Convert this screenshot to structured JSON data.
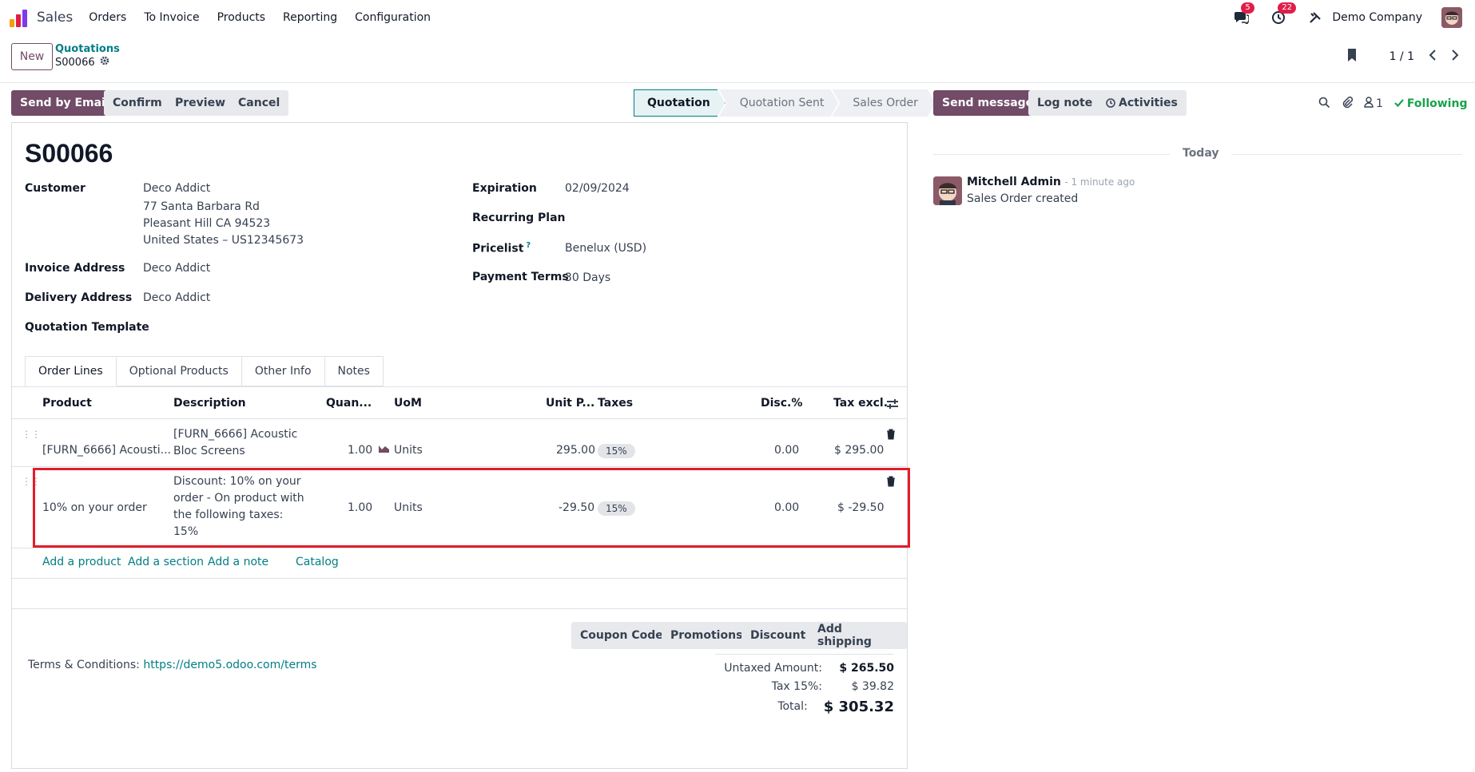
{
  "navbar": {
    "app_name": "Sales",
    "menu": [
      "Orders",
      "To Invoice",
      "Products",
      "Reporting",
      "Configuration"
    ],
    "messages_count": "5",
    "activities_count": "22",
    "company": "Demo Company"
  },
  "control": {
    "new_label": "New",
    "breadcrumb_parent": "Quotations",
    "breadcrumb_current": "S00066",
    "pager": "1 / 1"
  },
  "actions": {
    "send_email": "Send by Email",
    "confirm": "Confirm",
    "preview": "Preview",
    "cancel": "Cancel"
  },
  "status": {
    "stages": [
      "Quotation",
      "Quotation Sent",
      "Sales Order"
    ],
    "current": "Quotation"
  },
  "form": {
    "reference": "S00066",
    "customer_label": "Customer",
    "customer_name": "Deco Addict",
    "customer_street": "77 Santa Barbara Rd",
    "customer_city": "Pleasant Hill CA 94523",
    "customer_country": "United States – US12345673",
    "invoice_address_label": "Invoice Address",
    "invoice_address": "Deco Addict",
    "delivery_address_label": "Delivery Address",
    "delivery_address": "Deco Addict",
    "template_label": "Quotation Template",
    "expiration_label": "Expiration",
    "expiration": "02/09/2024",
    "recurring_label": "Recurring Plan",
    "pricelist_label": "Pricelist",
    "pricelist_help": "?",
    "pricelist": "Benelux (USD)",
    "payment_terms_label": "Payment Terms",
    "payment_terms": "30 Days"
  },
  "tabs": [
    "Order Lines",
    "Optional Products",
    "Other Info",
    "Notes"
  ],
  "table": {
    "headers": [
      "Product",
      "Description",
      "Quan...",
      "UoM",
      "Unit P...",
      "Taxes",
      "Disc.%",
      "Tax excl."
    ],
    "rows": [
      {
        "product": "[FURN_6666] Acousti...",
        "description_1": "[FURN_6666] Acoustic",
        "description_2": "Bloc Screens",
        "quantity": "1.00",
        "uom": "Units",
        "unit_price": "295.00",
        "tax": "15%",
        "discount": "0.00",
        "subtotal": "$ 295.00"
      },
      {
        "product": "10% on your order",
        "description_1": "Discount: 10% on your",
        "description_2": "order - On product with",
        "description_3": "the following taxes:",
        "description_4": "15%",
        "quantity": "1.00",
        "uom": "Units",
        "unit_price": "-29.50",
        "tax": "15%",
        "discount": "0.00",
        "subtotal": "$ -29.50"
      }
    ],
    "add_product": "Add a product",
    "add_section": "Add a section",
    "add_note": "Add a note",
    "catalog": "Catalog"
  },
  "footer_buttons": {
    "coupon": "Coupon Code",
    "promotions": "Promotions",
    "discount": "Discount",
    "shipping": "Add shipping"
  },
  "terms": {
    "label": "Terms & Conditions:",
    "link": "https://demo5.odoo.com/terms"
  },
  "totals": {
    "untaxed_label": "Untaxed Amount:",
    "untaxed": "$ 265.50",
    "tax_label": "Tax 15%:",
    "tax": "$ 39.82",
    "total_label": "Total:",
    "total": "$ 305.32"
  },
  "chatter": {
    "send_message": "Send message",
    "log_note": "Log note",
    "activities": "Activities",
    "followers_count": "1",
    "following": "Following",
    "today": "Today",
    "author": "Mitchell Admin",
    "time": "- 1 minute ago",
    "message": "Sales Order created"
  },
  "colors": {
    "primary": "#714b67",
    "link": "#017e84",
    "highlight": "#e11d2a",
    "following": "#16a34a"
  }
}
